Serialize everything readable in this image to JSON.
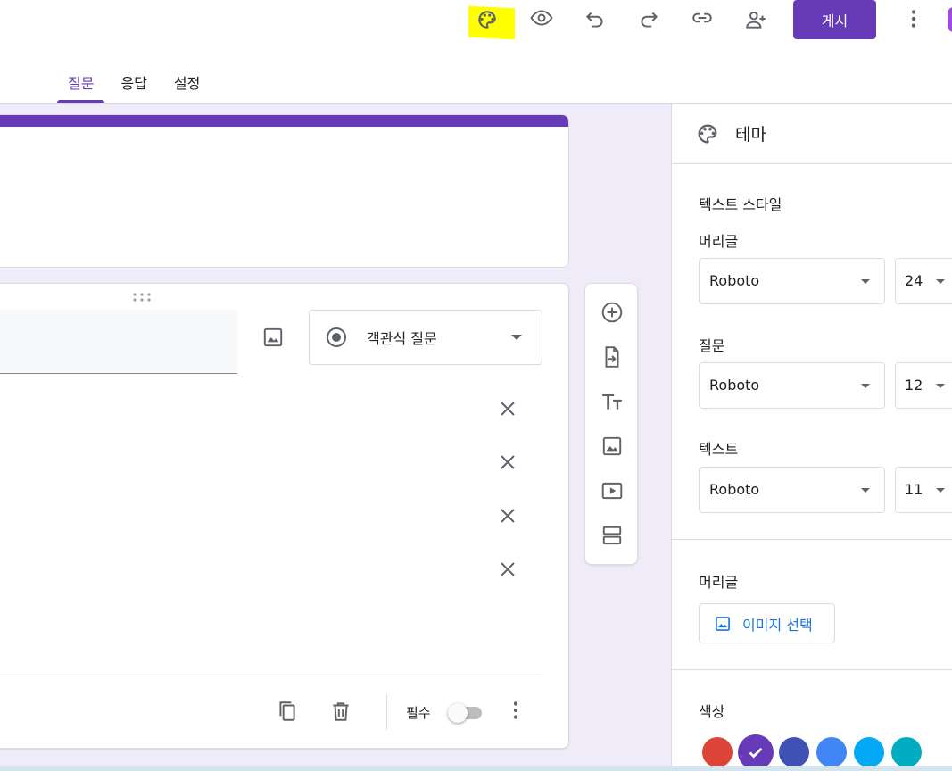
{
  "header": {
    "publish_label": "게시",
    "icons": [
      "palette-icon",
      "eye-icon",
      "undo-icon",
      "redo-icon",
      "link-icon",
      "add-person-icon",
      "more-vert-icon"
    ]
  },
  "tabs": [
    {
      "label": "질문",
      "active": true
    },
    {
      "label": "응답",
      "active": false
    },
    {
      "label": "설정",
      "active": false
    }
  ],
  "question": {
    "type_label": "객관식 질문",
    "required_label": "필수",
    "required_on": false
  },
  "theme": {
    "title": "테마",
    "text_style_title": "텍스트 스타일",
    "header_label": "머리글",
    "header_font": "Roboto",
    "header_size": "24",
    "question_label": "질문",
    "question_font": "Roboto",
    "question_size": "12",
    "text_label": "텍스트",
    "text_font": "Roboto",
    "text_size": "11",
    "header_image_title": "머리글",
    "image_select_label": "이미지 선택",
    "color_title": "색상",
    "colors": [
      "#db4437",
      "#673ab7",
      "#3f51b5",
      "#4285f4",
      "#03a9f4",
      "#00acc1"
    ],
    "selected_color": "#673ab7"
  },
  "colors": {
    "accent": "#673ab7",
    "canvas_bg": "#f0ebf8",
    "highlight": "#ffff00"
  }
}
